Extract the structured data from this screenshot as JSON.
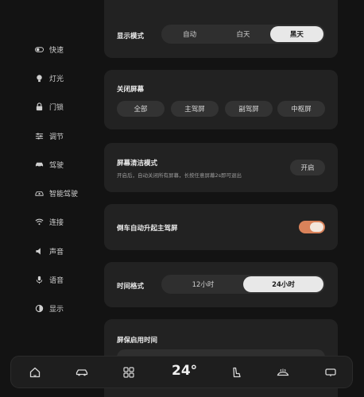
{
  "sidebar": {
    "items": [
      {
        "label": "快速",
        "icon": "toggle-icon"
      },
      {
        "label": "灯光",
        "icon": "bulb-icon"
      },
      {
        "label": "门锁",
        "icon": "lock-icon"
      },
      {
        "label": "调节",
        "icon": "adjust-icon"
      },
      {
        "label": "驾驶",
        "icon": "car-icon"
      },
      {
        "label": "智能驾驶",
        "icon": "smart-drive-icon"
      },
      {
        "label": "连接",
        "icon": "wifi-icon"
      },
      {
        "label": "声音",
        "icon": "speaker-icon"
      },
      {
        "label": "语音",
        "icon": "mic-icon"
      },
      {
        "label": "显示",
        "icon": "display-icon"
      }
    ]
  },
  "display_mode": {
    "title": "显示模式",
    "options": [
      "自动",
      "白天",
      "黑天"
    ],
    "selected": "黑天"
  },
  "close_screen": {
    "title": "关闭屏幕",
    "options": [
      "全部",
      "主驾屏",
      "副驾屏",
      "中枢屏"
    ]
  },
  "clean_mode": {
    "title": "屏幕清洁模式",
    "desc": "开启后，自动关闭所有屏幕，长按任意屏幕2s即可退出",
    "button": "开启"
  },
  "reverse_raise": {
    "title": "倒车自动升起主驾屏",
    "enabled": true
  },
  "time_format": {
    "title": "时间格式",
    "options": [
      "12小时",
      "24小时"
    ],
    "selected": "24小时"
  },
  "screensaver": {
    "title": "屏保启用时间"
  },
  "dock": {
    "temperature": "24°",
    "icons": [
      "home-icon",
      "car-icon",
      "apps-grid-icon",
      "seat-icon",
      "defrost-icon",
      "screen-icon"
    ]
  },
  "colors": {
    "background": "#131313",
    "card": "#222222",
    "accent": "#d9825a"
  }
}
